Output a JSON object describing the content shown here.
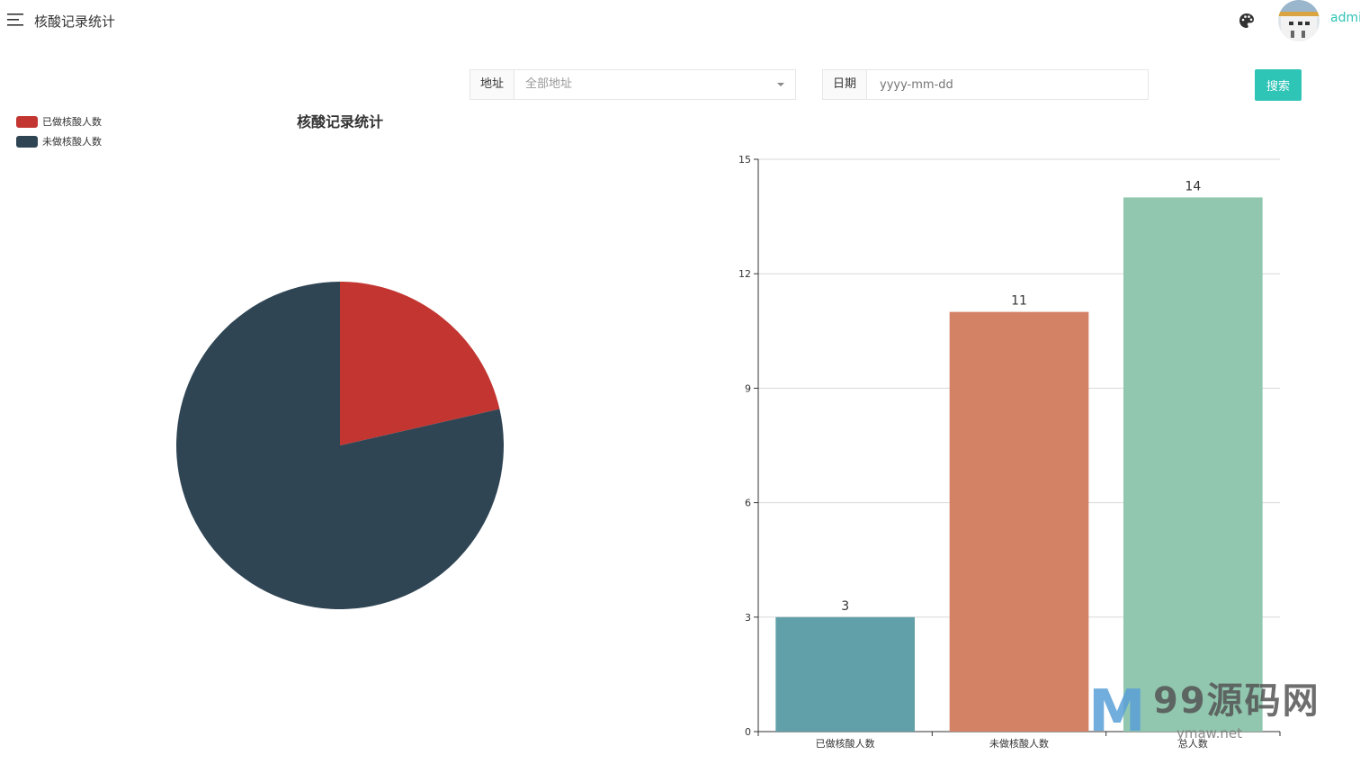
{
  "header": {
    "title": "核酸记录统计",
    "username": "admi",
    "menu_icon": "hamburger-menu-icon",
    "palette_icon": "palette-icon"
  },
  "filters": {
    "address_label": "地址",
    "address_value": "全部地址",
    "date_label": "日期",
    "date_placeholder": "yyyy-mm-dd",
    "search_label": "搜索"
  },
  "colors": {
    "accent": "#2ec4b6",
    "pie_done": "#c23531",
    "pie_not_done": "#2f4554",
    "bar_1": "#61a0a8",
    "bar_2": "#d48265",
    "bar_3": "#91c7ae"
  },
  "chart_data": [
    {
      "type": "pie",
      "title": "核酸记录统计",
      "legend": [
        "已做核酸人数",
        "未做核酸人数"
      ],
      "legend_position": "top-left",
      "slices": [
        {
          "name": "已做核酸人数",
          "value": 3,
          "color": "#c23531"
        },
        {
          "name": "未做核酸人数",
          "value": 11,
          "color": "#2f4554"
        }
      ]
    },
    {
      "type": "bar",
      "categories": [
        "已做核酸人数",
        "未做核酸人数",
        "总人数"
      ],
      "values": [
        3,
        11,
        14
      ],
      "colors": [
        "#61a0a8",
        "#d48265",
        "#91c7ae"
      ],
      "ylim": [
        0,
        15
      ],
      "yticks": [
        0,
        3,
        6,
        9,
        12,
        15
      ],
      "grid": true,
      "data_labels": true
    }
  ],
  "watermark": {
    "logo": "M",
    "text": "99源码网",
    "sub": "ymaw.net"
  }
}
